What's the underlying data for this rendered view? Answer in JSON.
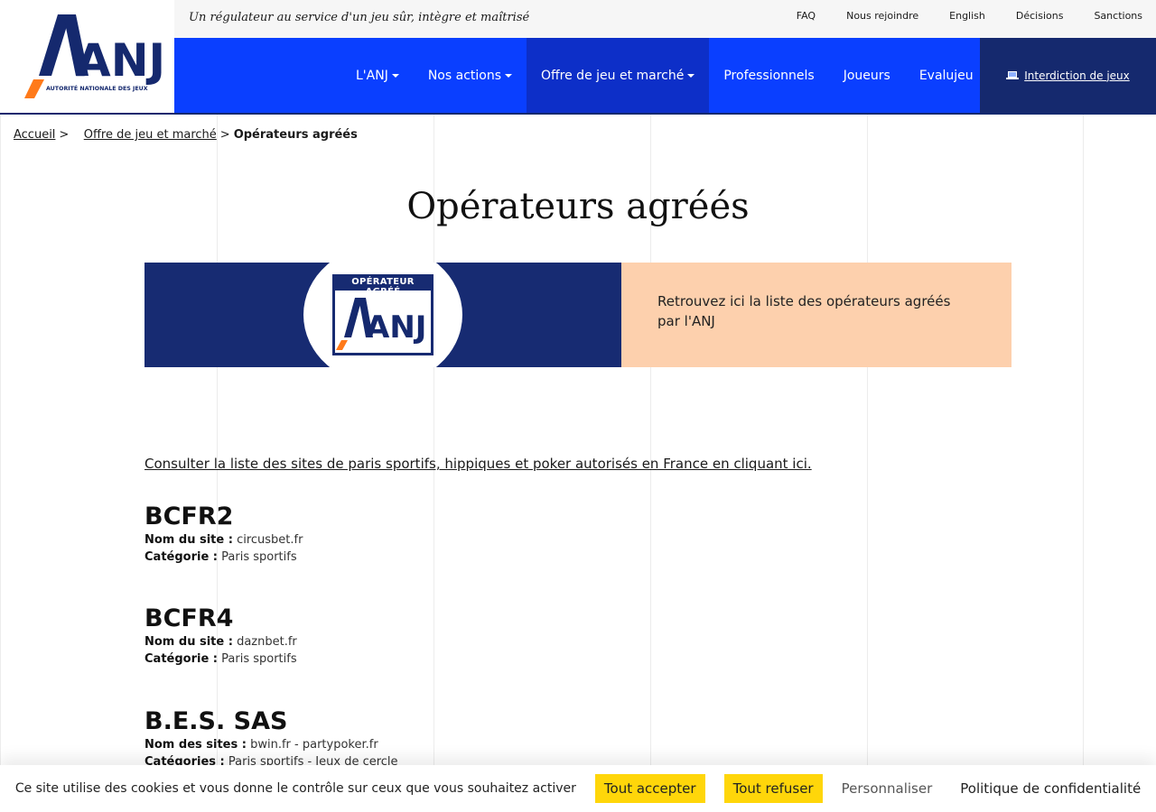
{
  "header": {
    "logo_text": "ANJ",
    "logo_subtitle": "AUTORITÉ NATIONALE DES JEUX",
    "tagline": "Un régulateur au service d'un jeu sûr, intègre et maîtrisé",
    "util_links": [
      "FAQ",
      "Nous rejoindre",
      "English",
      "Décisions",
      "Sanctions"
    ],
    "nav": [
      {
        "label": "L'ANJ",
        "dropdown": true
      },
      {
        "label": "Nos actions",
        "dropdown": true
      },
      {
        "label": "Offre de jeu et marché",
        "dropdown": true,
        "active": true
      },
      {
        "label": "Professionnels",
        "dropdown": false
      },
      {
        "label": "Joueurs",
        "dropdown": false
      },
      {
        "label": "Evalujeu",
        "dropdown": false
      }
    ],
    "interdiction_label": "Interdiction de jeux"
  },
  "breadcrumb": {
    "home": "Accueil",
    "sep": ">",
    "parent": "Offre de jeu et marché",
    "current": "Opérateurs agréés"
  },
  "page": {
    "title": "Opérateurs agréés",
    "badge_label": "OPÉRATEUR AGRÉÉ",
    "badge_logo_text": "ANJ",
    "intro": "Retrouvez ici la liste des opérateurs agréés par l'ANJ",
    "consult_link": "Consulter la liste des sites de paris sportifs, hippiques et poker autorisés en France en cliquant ici."
  },
  "operators": [
    {
      "name": "BCFR2",
      "site_label": "Nom du site :",
      "site": "circusbet.fr",
      "cat_label": "Catégorie :",
      "category": "Paris sportifs"
    },
    {
      "name": "BCFR4",
      "site_label": "Nom du site :",
      "site": "daznbet.fr",
      "cat_label": "Catégorie :",
      "category": "Paris sportifs"
    },
    {
      "name": "B.E.S. SAS",
      "site_label": "Nom des sites :",
      "site": "bwin.fr - partypoker.fr",
      "cat_label": "Catégories :",
      "category": "Paris sportifs - Jeux de cercle"
    }
  ],
  "cookies": {
    "text": "Ce site utilise des cookies et vous donne le contrôle sur ceux que vous souhaitez activer",
    "accept": "Tout accepter",
    "refuse": "Tout refuser",
    "customize": "Personnaliser",
    "policy": "Politique de confidentialité"
  },
  "colors": {
    "brand_blue": "#0a3fff",
    "navy": "#15296e",
    "orange": "#ff7a1a",
    "peach": "#fdd0ad",
    "cookie_yellow": "#ffd60a"
  }
}
